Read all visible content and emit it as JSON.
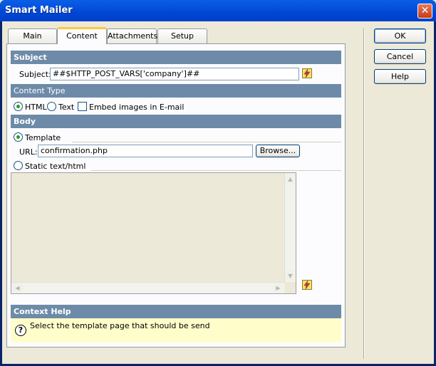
{
  "window": {
    "title": "Smart Mailer",
    "close_glyph": "✕"
  },
  "tabs": [
    {
      "label": "Main"
    },
    {
      "label": "Content",
      "active": true
    },
    {
      "label": "Attachments"
    },
    {
      "label": "Setup"
    }
  ],
  "subject_section": {
    "header": "Subject",
    "label": "Subject:",
    "value": "##$HTTP_POST_VARS['company']##"
  },
  "content_type": {
    "header": "Content Type",
    "html_label": "HTML",
    "text_label": "Text",
    "embed_label": "Embed images in E-mail",
    "selected": "HTML",
    "embed_checked": false
  },
  "body_section": {
    "header": "Body",
    "template_label": "Template",
    "url_label": "URL:",
    "url_value": "confirmation.php",
    "browse_label": "Browse...",
    "static_label": "Static text/html",
    "selected": "Template"
  },
  "context_help": {
    "header": "Context Help",
    "icon": "?",
    "text": "Select the template page that should be send"
  },
  "buttons": {
    "ok": "OK",
    "cancel": "Cancel",
    "help": "Help"
  },
  "icons": {
    "dynamic_data": "lightning-bolt-icon",
    "scroll_up": "▲",
    "scroll_down": "▼",
    "scroll_left": "◀",
    "scroll_right": "▶"
  },
  "colors": {
    "section_header": "#6d8ba8",
    "help_background": "#fffecb",
    "titlebar": "#0046d5"
  }
}
